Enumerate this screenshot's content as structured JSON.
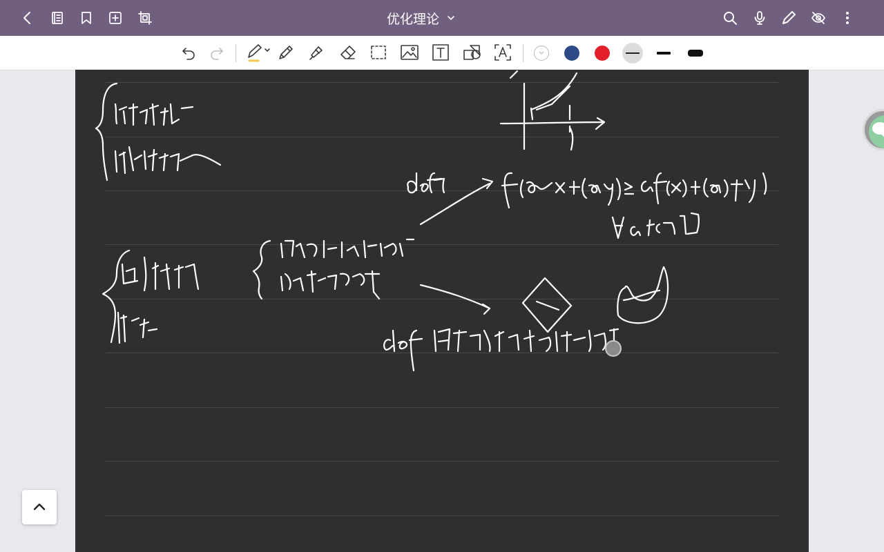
{
  "app": {
    "notebook_title": "优化理论"
  },
  "topbar": {
    "left_icons": [
      "back-icon",
      "notebook-pages-icon",
      "bookmark-icon",
      "add-page-icon",
      "crop-icon"
    ],
    "right_icons": [
      "search-icon",
      "microphone-icon",
      "pen-mode-icon",
      "hide-icon",
      "more-icon"
    ]
  },
  "toolbar": {
    "tools": [
      "undo-icon",
      "redo-icon",
      "pen-tool-icon",
      "pencil-icon",
      "highlighter-icon",
      "eraser-icon",
      "lasso-select-icon",
      "image-icon",
      "text-box-icon",
      "shape-icon",
      "ocr-text-icon"
    ],
    "colors": [
      {
        "name": "empty-color-swatch",
        "hex": "#ffffff"
      },
      {
        "name": "navy-color-swatch",
        "hex": "#2b4a86"
      },
      {
        "name": "red-color-swatch",
        "hex": "#e5202b"
      }
    ],
    "active_pen_color": "#f2c94c",
    "stroke_widths": [
      "thin",
      "medium",
      "thick"
    ],
    "selected_stroke_width": "thin"
  },
  "page": {
    "background": "#2f2f2f",
    "ink_color": "#ffffff",
    "ruled_lines": 9
  },
  "colors": {
    "topbar": "#705f7e",
    "toolbar": "#ffffff",
    "canvas_surround": "#e8e9ec"
  }
}
